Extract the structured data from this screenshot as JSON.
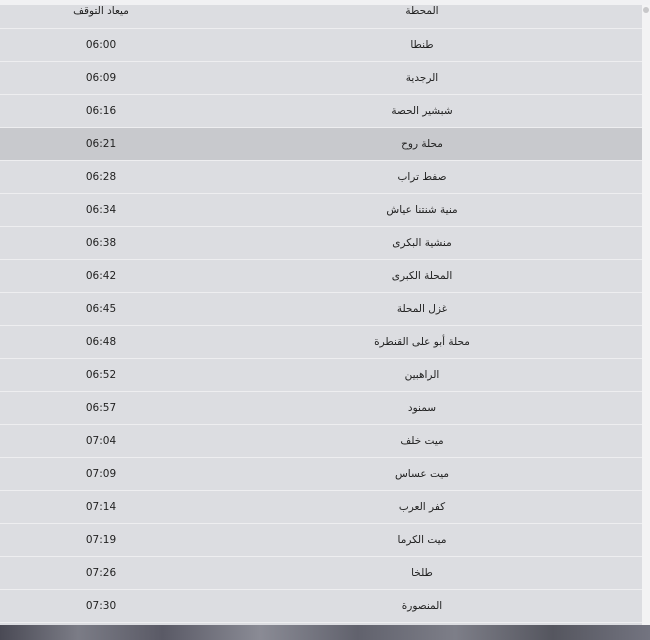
{
  "table": {
    "headers": {
      "station": "المحطة",
      "stop_time": "ميعاد التوقف"
    },
    "rows": [
      {
        "station": "طنطا",
        "time": "06:00"
      },
      {
        "station": "الرجدية",
        "time": "06:09"
      },
      {
        "station": "شبشير الحصة",
        "time": "06:16"
      },
      {
        "station": "محلة روح",
        "time": "06:21"
      },
      {
        "station": "صفط تراب",
        "time": "06:28"
      },
      {
        "station": "منية شنتنا عياش",
        "time": "06:34"
      },
      {
        "station": "منشية البكرى",
        "time": "06:38"
      },
      {
        "station": "المحلة الكبرى",
        "time": "06:42"
      },
      {
        "station": "غزل المحلة",
        "time": "06:45"
      },
      {
        "station": "محلة أبو على القنطرة",
        "time": "06:48"
      },
      {
        "station": "الراهبين",
        "time": "06:52"
      },
      {
        "station": "سمنود",
        "time": "06:57"
      },
      {
        "station": "ميت خلف",
        "time": "07:04"
      },
      {
        "station": "ميت عساس",
        "time": "07:09"
      },
      {
        "station": "كفر العرب",
        "time": "07:14"
      },
      {
        "station": "ميت الكرما",
        "time": "07:19"
      },
      {
        "station": "طلخا",
        "time": "07:26"
      },
      {
        "station": "المنصورة",
        "time": "07:30"
      }
    ],
    "highlighted_row": 3
  },
  "colors": {
    "panel_bg": "#dcdde1",
    "row_highlight": "#c8c9cd",
    "row_divider": "#eeeef0",
    "text": "#222222"
  }
}
